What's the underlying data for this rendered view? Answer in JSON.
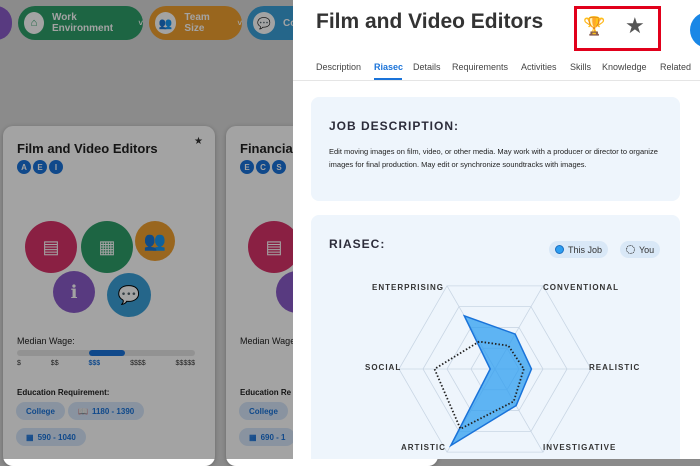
{
  "filters": [
    {
      "label": "Work Environment",
      "color": "#2e9e6a"
    },
    {
      "label": "Team Size",
      "color": "#f0a030"
    },
    {
      "label": "Com",
      "color": "#3aa0d8"
    }
  ],
  "cards": [
    {
      "title": "Film and Video Editors",
      "codes": [
        "A",
        "E",
        "I"
      ],
      "wage_label": "Median Wage:",
      "wage_ticks": [
        "$",
        "$$",
        "$$$",
        "$$$$",
        "$$$$$"
      ],
      "wage_level": 3,
      "edu_label": "Education Requirement:",
      "chips": [
        "College",
        "1180 - 1390",
        "590 - 1040"
      ]
    },
    {
      "title": "Financia",
      "codes": [
        "E",
        "C",
        "S"
      ],
      "wage_label": "Median Wage:",
      "edu_label": "Education Re",
      "chips": [
        "College",
        "690 - 1"
      ]
    }
  ],
  "panel": {
    "title": "Film and Video Editors",
    "tabs": [
      "Description",
      "Riasec",
      "Details",
      "Requirements",
      "Activities",
      "Skills",
      "Knowledge",
      "Related"
    ],
    "active_tab": "Riasec",
    "job_description": {
      "heading": "JOB DESCRIPTION:",
      "text": "Edit moving images on film, video, or other media. May work with a producer or director to organize images for final production. May edit or synchronize soundtracks with images."
    },
    "riasec": {
      "heading": "RIASEC:",
      "legend_this_job": "This Job",
      "legend_you": "You",
      "labels": {
        "enterprising": "ENTERPRISING",
        "conventional": "CONVENTIONAL",
        "realistic": "REALISTIC",
        "investigative": "INVESTIGATIVE",
        "artistic": "ARTISTIC",
        "social": "SOCIAL"
      }
    }
  },
  "chart_data": {
    "type": "radar",
    "axes": [
      "Realistic",
      "Investigative",
      "Artistic",
      "Social",
      "Enterprising",
      "Conventional"
    ],
    "range": [
      0,
      1
    ],
    "grid_levels": 4,
    "series": [
      {
        "name": "This Job",
        "values": [
          0.38,
          0.44,
          0.92,
          0.05,
          0.64,
          0.42
        ],
        "color": "#2d9df0"
      },
      {
        "name": "You",
        "values": [
          0.3,
          0.39,
          0.72,
          0.63,
          0.33,
          0.28
        ],
        "color": "#222222"
      }
    ]
  }
}
